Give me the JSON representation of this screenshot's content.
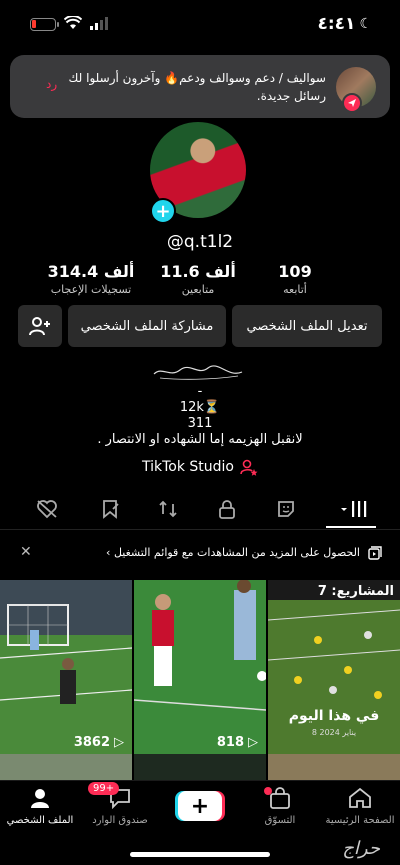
{
  "status_bar": {
    "time": "٤:٤١"
  },
  "notification": {
    "text": "سواليف / دعم وسوالف ودعم🔥 وآخرون أرسلوا لك رسائل جديدة.",
    "reply_label": "رد"
  },
  "profile": {
    "username": "@q.t1l2",
    "stats": [
      {
        "value": "109",
        "label": "أتابعه"
      },
      {
        "value": "11.6 ألف",
        "label": "متابعين"
      },
      {
        "value": "314.4 ألف",
        "label": "تسجيلات الإعجاب"
      }
    ],
    "buttons": {
      "edit": "تعديل الملف الشخصي",
      "share": "مشاركة الملف الشخصي"
    },
    "bio_lines": [
      "-",
      "12k⏳",
      "311",
      "لانقبل الهزيمه إما الشهاده او الانتصار ."
    ],
    "studio_label": "TikTok Studio"
  },
  "playlist_banner": {
    "text": "الحصول على المزيد من المشاهدات مع قوائم التشغيل ›"
  },
  "grid": {
    "cells": [
      {
        "views": "3862",
        "overlay": ""
      },
      {
        "views": "818",
        "overlay": ""
      },
      {
        "views": "",
        "overlay": "المشاريع: 7",
        "caption": "في هذا اليوم",
        "date": "8 يناير 2024"
      }
    ]
  },
  "bottom_nav": {
    "items": [
      {
        "label": "الصفحة الرئيسية",
        "icon": "home-icon"
      },
      {
        "label": "التسوّق",
        "icon": "shop-icon"
      },
      {
        "label": "",
        "icon": "plus-icon"
      },
      {
        "label": "صندوق الوارد",
        "icon": "inbox-icon",
        "badge": "99+"
      },
      {
        "label": "الملف الشخصي",
        "icon": "profile-icon"
      }
    ]
  },
  "watermark": "حراج",
  "colors": {
    "accent_red": "#fe2c55",
    "accent_cyan": "#20d5ec",
    "background": "#000000"
  }
}
